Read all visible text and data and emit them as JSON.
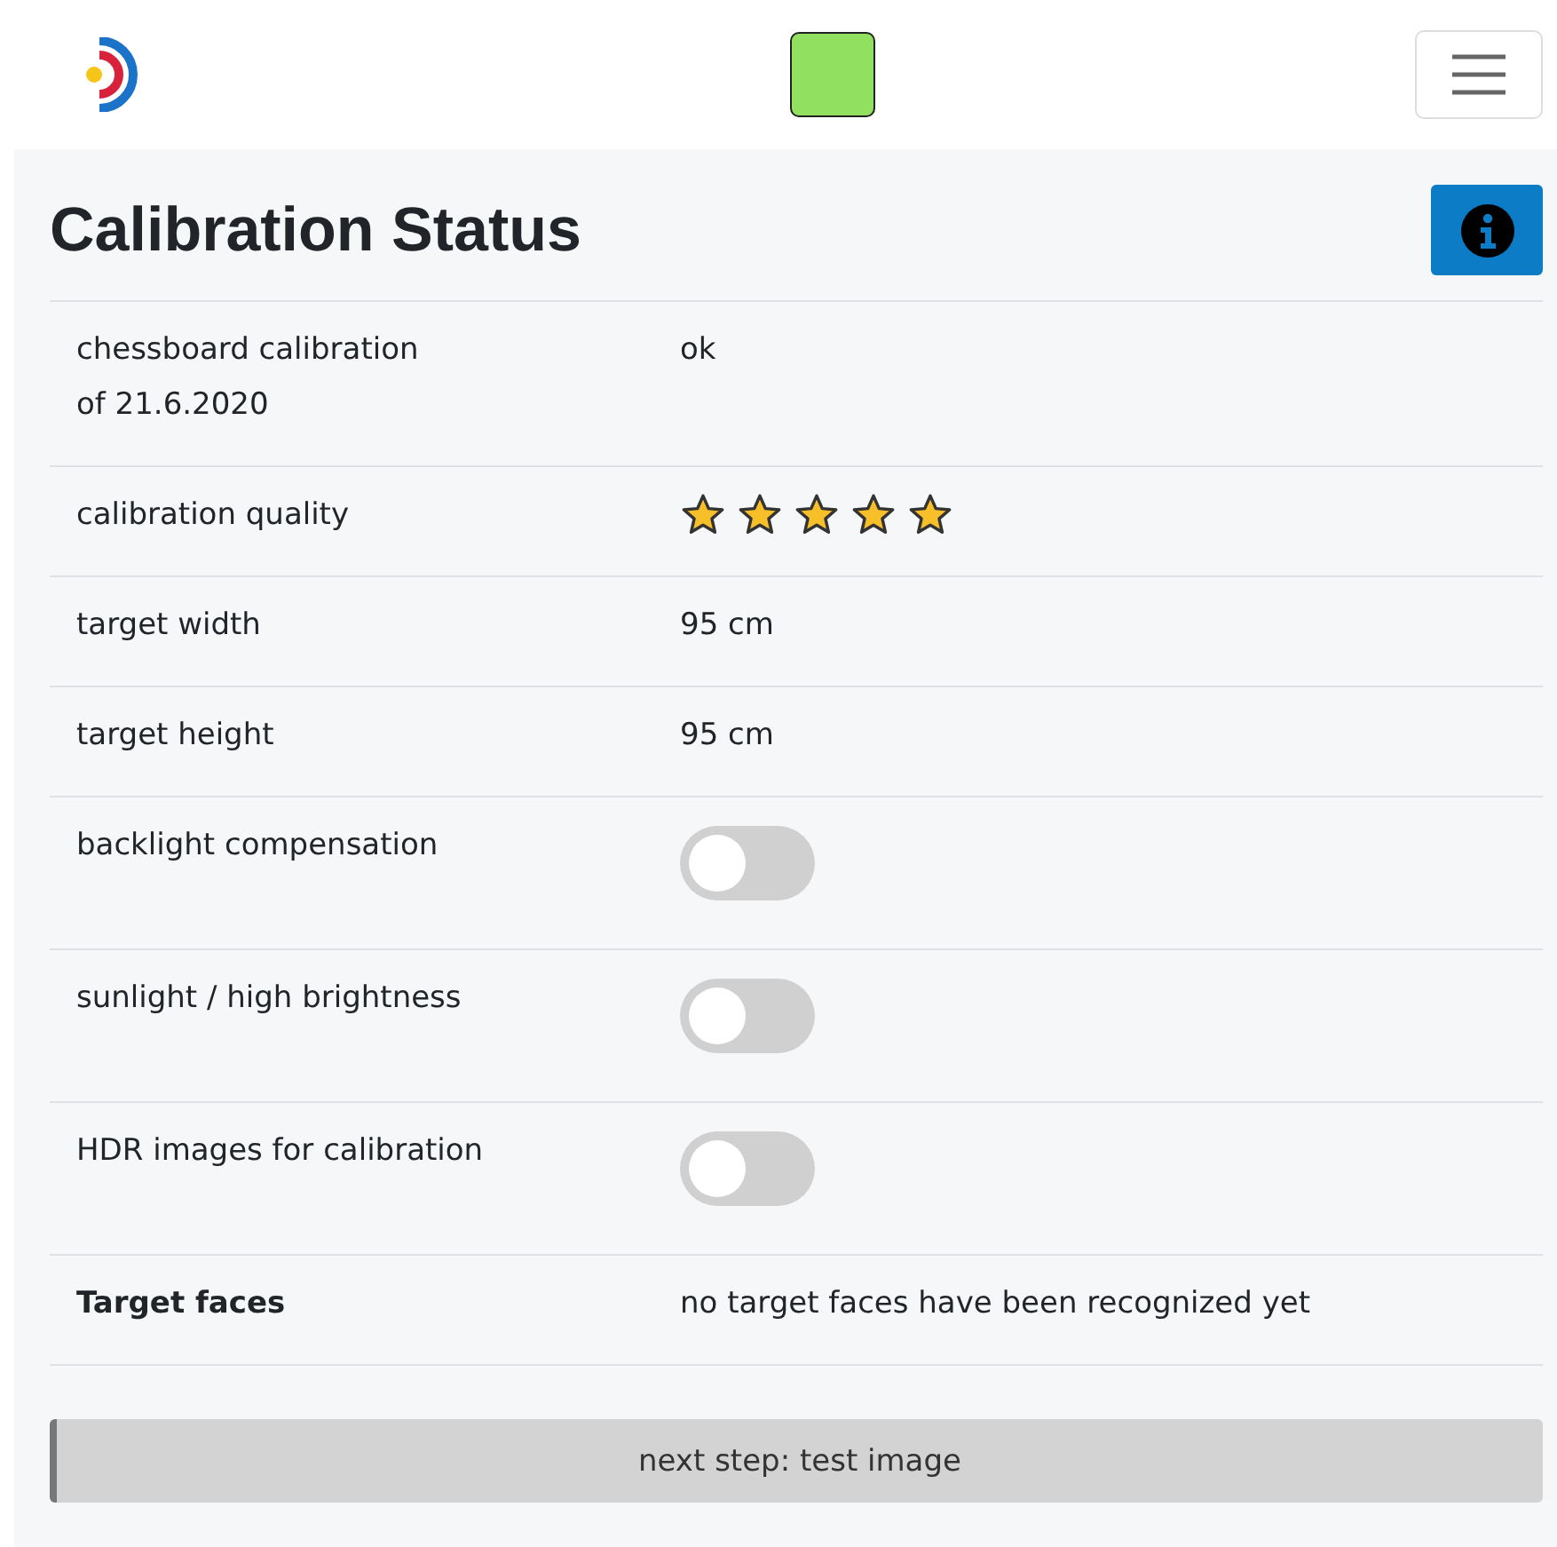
{
  "title": "Calibration Status",
  "rows": [
    {
      "kind": "text",
      "label": "chessboard calibration\nof 21.6.2020",
      "value": "ok"
    },
    {
      "kind": "stars",
      "label": "calibration quality",
      "stars": 5
    },
    {
      "kind": "text",
      "label": "target width",
      "value": "95 cm"
    },
    {
      "kind": "text",
      "label": "target height",
      "value": "95 cm"
    },
    {
      "kind": "toggle",
      "label": "backlight compensation",
      "on": false
    },
    {
      "kind": "toggle",
      "label": "sunlight / high brightness",
      "on": false
    },
    {
      "kind": "toggle",
      "label": "HDR images for calibration",
      "on": false
    },
    {
      "kind": "heading",
      "label": "Target faces",
      "value": "no target faces have been recognized yet"
    }
  ],
  "next_button": "next step: test image"
}
